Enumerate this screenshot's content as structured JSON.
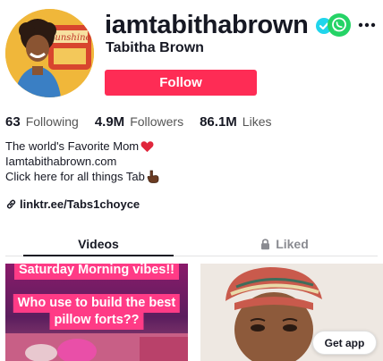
{
  "profile": {
    "handle": "iamtabithabrown",
    "display_name": "Tabitha Brown",
    "verified_icon": "verified-check-icon",
    "follow_label": "Follow",
    "avatar_sign_text": "Sunshine"
  },
  "stats": [
    {
      "value": "63",
      "label": "Following"
    },
    {
      "value": "4.9M",
      "label": "Followers"
    },
    {
      "value": "86.1M",
      "label": "Likes"
    }
  ],
  "bio": {
    "line1": "The world's Favorite Mom",
    "line2": "Iamtabithabrown.com",
    "line3": "Click here for all things Tab",
    "link": "linktr.ee/Tabs1choyce"
  },
  "tabs": {
    "videos": "Videos",
    "liked": "Liked"
  },
  "videos": [
    {
      "captions": [
        "Saturday Morning vibes!!",
        "Who use to build the best",
        "pillow forts??"
      ]
    },
    {
      "captions": []
    }
  ],
  "get_app_label": "Get app",
  "colors": {
    "accent": "#fe2c55",
    "verified": "#20d5ec",
    "whatsapp": "#25d366",
    "caption_bg": "#ff3b86"
  }
}
